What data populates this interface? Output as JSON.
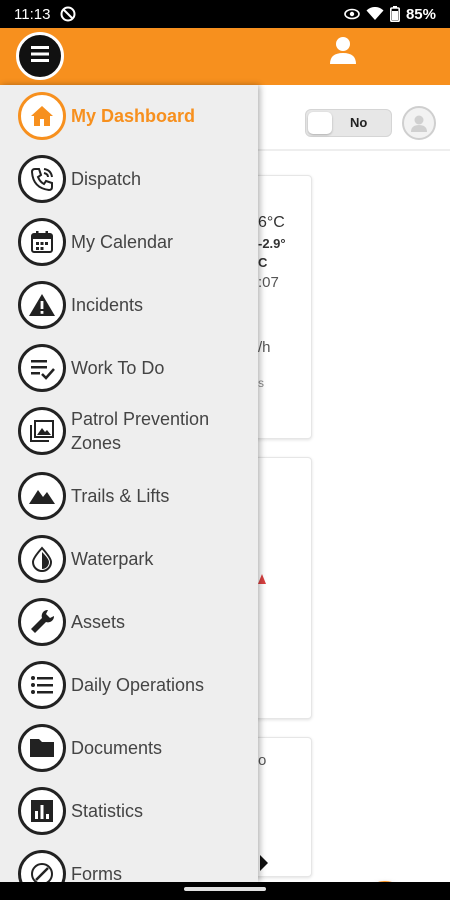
{
  "status_bar": {
    "time": "11:13",
    "battery": "85%",
    "icons": [
      "do-not-disturb-icon",
      "eye-icon",
      "wifi-icon",
      "battery-icon"
    ]
  },
  "app_bar": {
    "accent_color": "#f7901e",
    "left_icon": "hamburger-icon",
    "right_icon": "user-icon"
  },
  "header": {
    "toggle_label": "No",
    "toggle_state": false
  },
  "weather_card": {
    "temp_fragment": "6°C",
    "range_fragment": "-2.9°",
    "unit_fragment": "C",
    "time_fragment": ":07",
    "wind_fragment": "/h",
    "misc_fragment": "s"
  },
  "card3": {
    "text_fragment": "o"
  },
  "menu": {
    "items": [
      {
        "label": "My Dashboard",
        "icon": "home-icon",
        "active": true
      },
      {
        "label": "Dispatch",
        "icon": "phone-icon",
        "active": false
      },
      {
        "label": "My Calendar",
        "icon": "calendar-icon",
        "active": false
      },
      {
        "label": "Incidents",
        "icon": "warning-icon",
        "active": false
      },
      {
        "label": "Work To Do",
        "icon": "checklist-icon",
        "active": false
      },
      {
        "label": "Patrol Prevention Zones",
        "icon": "image-icon",
        "active": false
      },
      {
        "label": "Trails & Lifts",
        "icon": "mountain-icon",
        "active": false
      },
      {
        "label": "Waterpark",
        "icon": "water-drop-icon",
        "active": false
      },
      {
        "label": "Assets",
        "icon": "wrench-icon",
        "active": false
      },
      {
        "label": "Daily Operations",
        "icon": "list-icon",
        "active": false
      },
      {
        "label": "Documents",
        "icon": "folder-icon",
        "active": false
      },
      {
        "label": "Statistics",
        "icon": "bar-chart-icon",
        "active": false
      },
      {
        "label": "Forms",
        "icon": "forms-icon",
        "active": false
      }
    ]
  },
  "fab": {
    "icon": "menu-icon",
    "color": "#f7901e"
  }
}
